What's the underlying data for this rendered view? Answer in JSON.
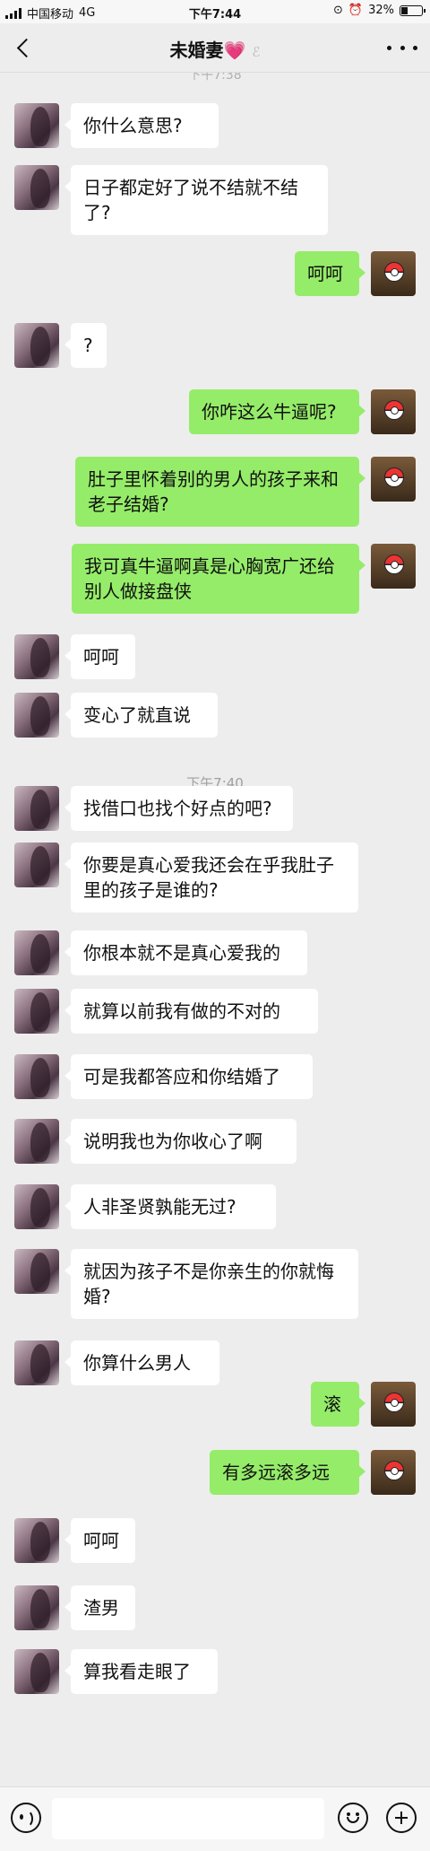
{
  "status": {
    "carrier": "中国移动",
    "network": "4G",
    "time": "下午7:44",
    "battery": "32%",
    "battery_level": 0.32
  },
  "header": {
    "title": "未婚妻",
    "heart": "💗",
    "muted_icon": "ear-icon"
  },
  "timestamps": {
    "partial": "下午7:38",
    "t740": "下午7:40"
  },
  "messages": [
    {
      "side": "left",
      "text": "你什么意思?"
    },
    {
      "side": "left",
      "text": "日子都定好了说不结就不结了?"
    },
    {
      "side": "right",
      "text": "呵呵"
    },
    {
      "side": "left",
      "text": "?"
    },
    {
      "side": "right",
      "text": "你咋这么牛逼呢?"
    },
    {
      "side": "right",
      "text": "肚子里怀着别的男人的孩子来和老子结婚?"
    },
    {
      "side": "right",
      "text": "我可真牛逼啊真是心胸宽广还给别人做接盘侠"
    },
    {
      "side": "left",
      "text": "呵呵"
    },
    {
      "side": "left",
      "text": "变心了就直说"
    },
    {
      "side": "left",
      "text": "找借口也找个好点的吧?"
    },
    {
      "side": "left",
      "text": "你要是真心爱我还会在乎我肚子里的孩子是谁的?"
    },
    {
      "side": "left",
      "text": "你根本就不是真心爱我的"
    },
    {
      "side": "left",
      "text": "就算以前我有做的不对的"
    },
    {
      "side": "left",
      "text": "可是我都答应和你结婚了"
    },
    {
      "side": "left",
      "text": "说明我也为你收心了啊"
    },
    {
      "side": "left",
      "text": "人非圣贤孰能无过?"
    },
    {
      "side": "left",
      "text": "就因为孩子不是你亲生的你就悔婚?"
    },
    {
      "side": "left",
      "text": "你算什么男人"
    },
    {
      "side": "right",
      "text": "滚"
    },
    {
      "side": "right",
      "text": "有多远滚多远"
    },
    {
      "side": "left",
      "text": "呵呵"
    },
    {
      "side": "left",
      "text": "渣男"
    },
    {
      "side": "left",
      "text": "算我看走眼了"
    }
  ]
}
